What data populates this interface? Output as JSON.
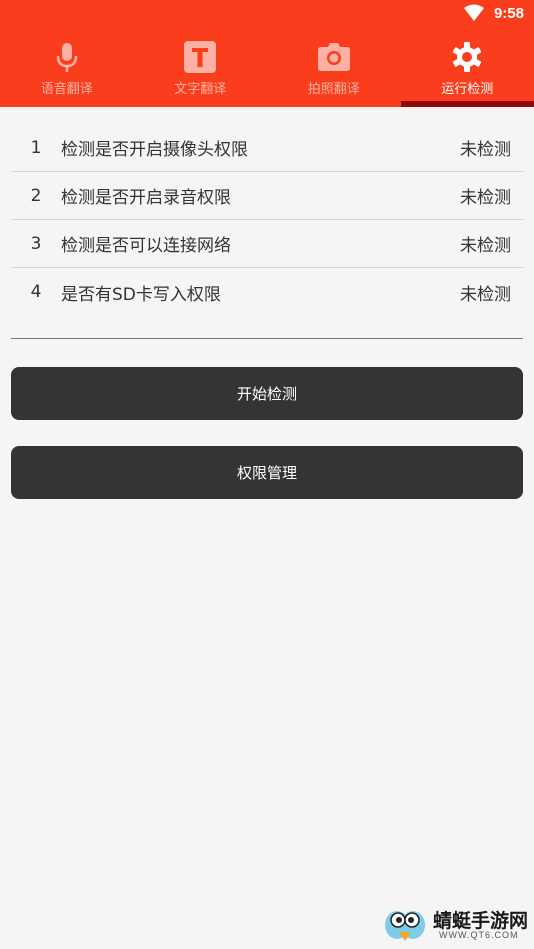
{
  "status_bar": {
    "time": "9:58",
    "wifi_icon": "wifi-icon"
  },
  "colors": {
    "header": "#fa3e1d",
    "underline": "#8e0a0a",
    "button": "#343434",
    "background": "#f5f5f5"
  },
  "tabs": [
    {
      "label": "语音翻译",
      "icon": "microphone-icon",
      "active": false
    },
    {
      "label": "文字翻译",
      "icon": "text-t-icon",
      "active": false
    },
    {
      "label": "拍照翻译",
      "icon": "camera-icon",
      "active": false
    },
    {
      "label": "运行检测",
      "icon": "gear-icon",
      "active": true
    }
  ],
  "checks": [
    {
      "num": "1",
      "name": "检测是否开启摄像头权限",
      "status": "未检测"
    },
    {
      "num": "2",
      "name": "检测是否开启录音权限",
      "status": "未检测"
    },
    {
      "num": "3",
      "name": "检测是否可以连接网络",
      "status": "未检测"
    },
    {
      "num": "4",
      "name": "是否有SD卡写入权限",
      "status": "未检测"
    }
  ],
  "buttons": {
    "start": "开始检测",
    "permissions": "权限管理"
  },
  "watermark": {
    "title": "蜻蜓手游网",
    "subtitle": "WWW.QT6.COM"
  }
}
